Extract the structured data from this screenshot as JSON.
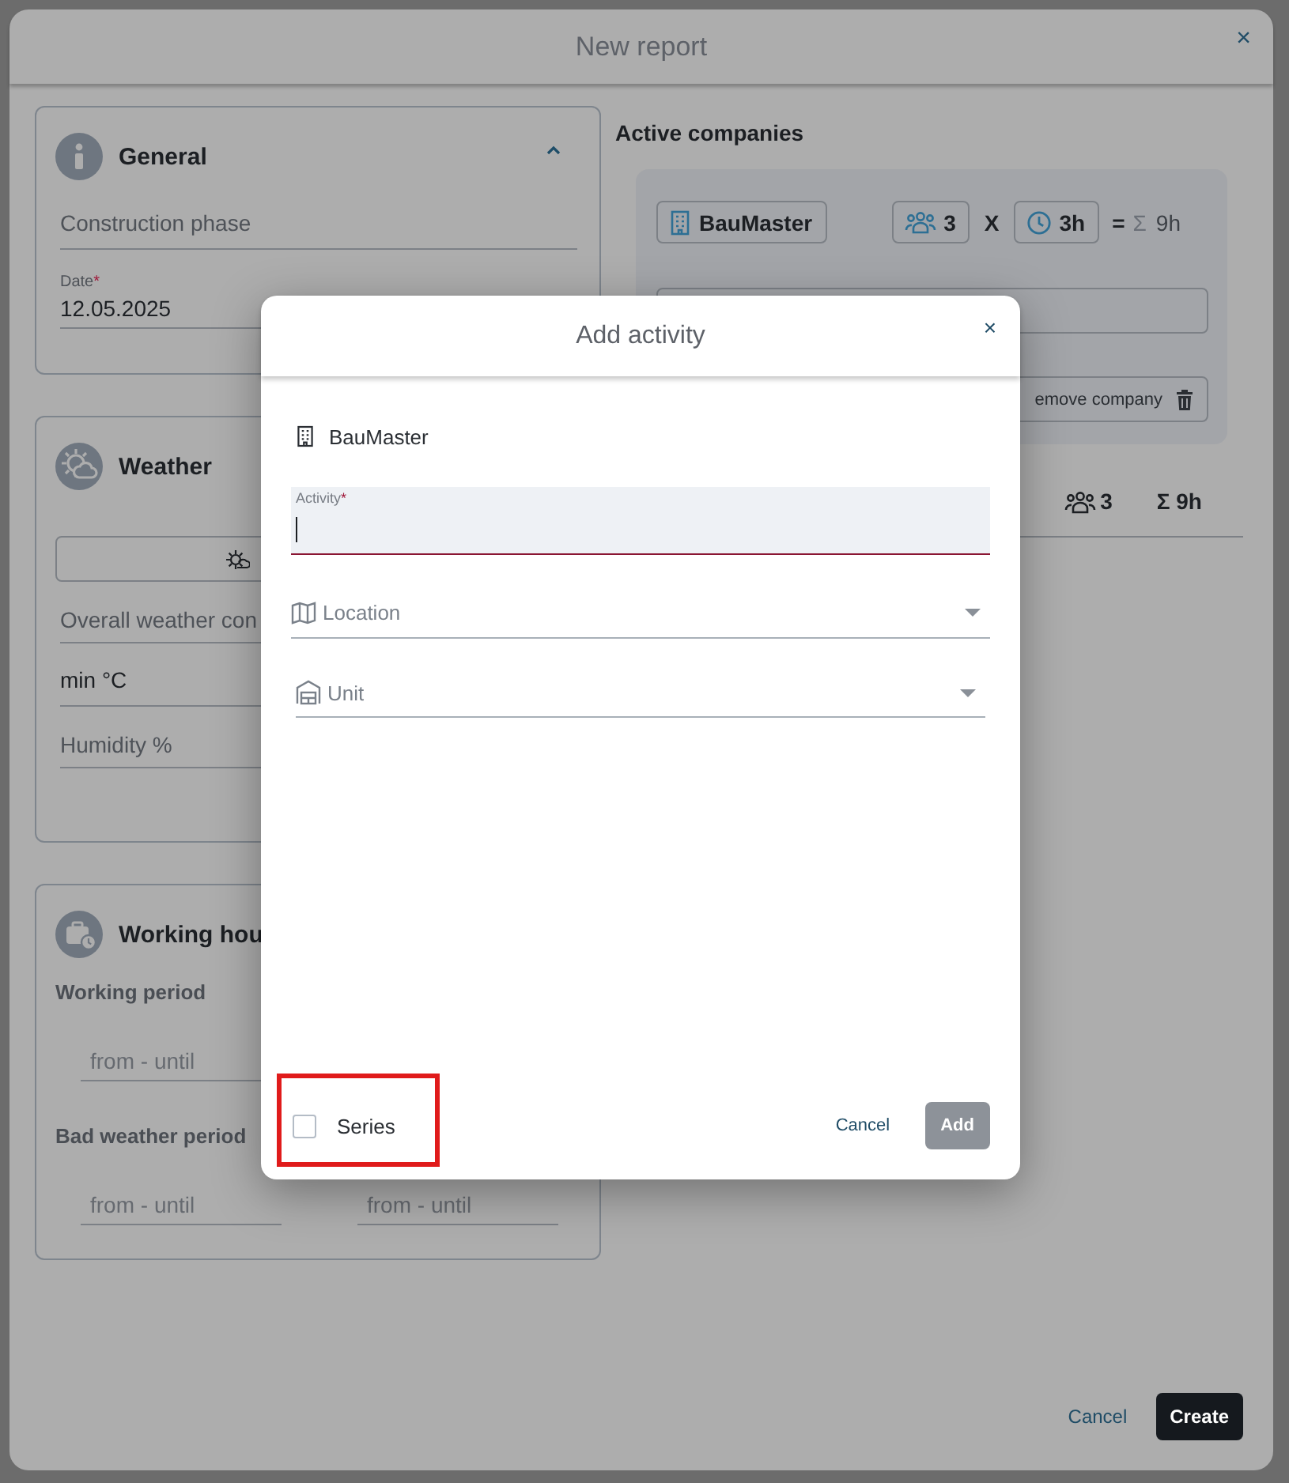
{
  "report": {
    "title": "New report",
    "close": "×",
    "general": {
      "title": "General",
      "expanded": true,
      "phase_placeholder": "Construction phase",
      "date_label": "Date",
      "date_required_mark": "*",
      "date_value": "12.05.2025"
    },
    "weather": {
      "title": "Weather",
      "condition_placeholder": "Overall weather con",
      "min_temp": "min °C",
      "humidity_placeholder": "Humidity %"
    },
    "working_hours": {
      "title": "Working hou",
      "working_period": "Working period",
      "working_placeholders": [
        "from - until"
      ],
      "bad_weather_period": "Bad weather period",
      "bad_weather_placeholders": [
        "from - until",
        "from - until"
      ]
    },
    "active_companies": {
      "title": "Active companies",
      "company": {
        "name": "BauMaster",
        "workers": "3",
        "times": "X",
        "hours": "3h",
        "equals": "=",
        "sum_symbol": "Σ",
        "total": "9h",
        "remove_label": "emove company"
      },
      "summary": {
        "workers": "3",
        "total": "Σ 9h"
      }
    },
    "buttons": [
      {
        "label": "Cancel",
        "kind": "link"
      },
      {
        "label": "Create",
        "kind": "primary"
      }
    ]
  },
  "add_activity": {
    "title": "Add activity",
    "close": "×",
    "company": "BauMaster",
    "activity": {
      "label": "Activity",
      "required_mark": "*",
      "focused": true
    },
    "location": {
      "placeholder": "Location"
    },
    "unit": {
      "placeholder": "Unit"
    },
    "series": {
      "label": "Series",
      "checked": false,
      "highlighted": true
    },
    "buttons": [
      {
        "label": "Cancel",
        "kind": "link",
        "disabled": false
      },
      {
        "label": "Add",
        "kind": "primary",
        "disabled": true
      }
    ]
  }
}
